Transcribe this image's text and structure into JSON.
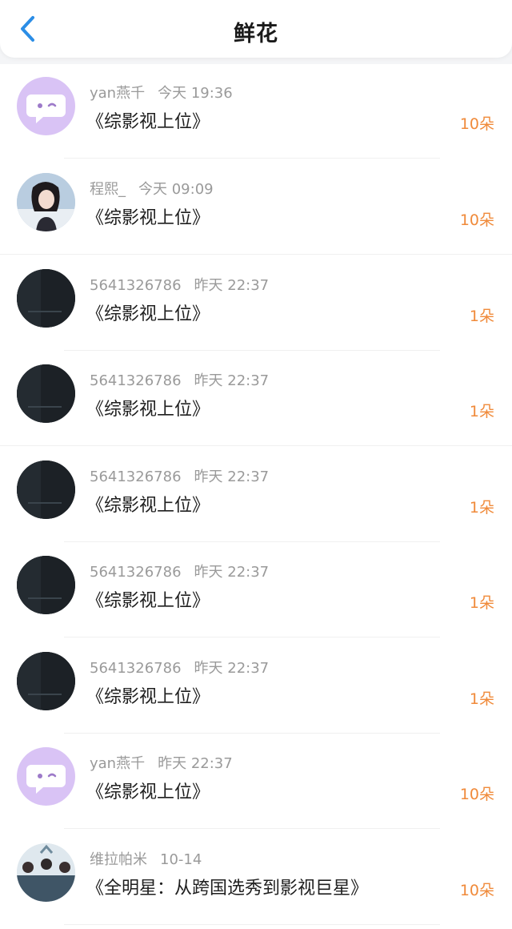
{
  "header": {
    "title": "鲜花"
  },
  "items": [
    {
      "user": "yan燕千",
      "time": "今天 19:36",
      "book": "《综影视上位》",
      "count": "10朵",
      "avatar": "purple-chat-avatar"
    },
    {
      "user": "程熙_",
      "time": "今天 09:09",
      "book": "《综影视上位》",
      "count": "10朵",
      "avatar": "girl-photo-avatar"
    },
    {
      "user": "5641326786",
      "time": "昨天 22:37",
      "book": "《综影视上位》",
      "count": "1朵",
      "avatar": "dark-photo-avatar"
    },
    {
      "user": "5641326786",
      "time": "昨天 22:37",
      "book": "《综影视上位》",
      "count": "1朵",
      "avatar": "dark-photo-avatar"
    },
    {
      "user": "5641326786",
      "time": "昨天 22:37",
      "book": "《综影视上位》",
      "count": "1朵",
      "avatar": "dark-photo-avatar"
    },
    {
      "user": "5641326786",
      "time": "昨天 22:37",
      "book": "《综影视上位》",
      "count": "1朵",
      "avatar": "dark-photo-avatar"
    },
    {
      "user": "5641326786",
      "time": "昨天 22:37",
      "book": "《综影视上位》",
      "count": "1朵",
      "avatar": "dark-photo-avatar"
    },
    {
      "user": "yan燕千",
      "time": "昨天 22:37",
      "book": "《综影视上位》",
      "count": "10朵",
      "avatar": "purple-chat-avatar"
    },
    {
      "user": "维拉帕米",
      "time": "10-14",
      "book": "《全明星：从跨国选秀到影视巨星》",
      "count": "10朵",
      "avatar": "group-photo-avatar"
    }
  ],
  "colors": {
    "accent_back": "#2b8de6",
    "count_orange": "#f08a3a",
    "avatar_purple": "#d9c3f5"
  },
  "icons": {
    "back": "chevron-left-icon"
  }
}
